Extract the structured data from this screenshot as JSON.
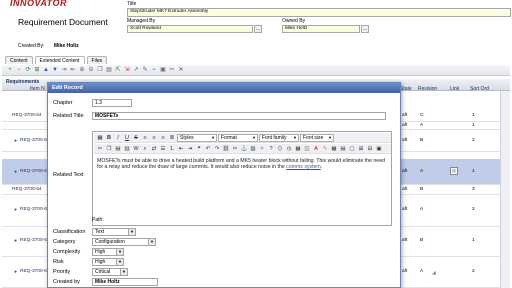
{
  "header": {
    "logo": "INNOVATOR",
    "doc_title": "Requirement Document",
    "created_by_label": "Created By:",
    "created_by_value": "Mike Holtz",
    "title_label": "Title",
    "title_value": "StepStruder MK7 Extruder Assembly",
    "managed_by_label": "Managed By",
    "managed_by_value": "Scott Rowland",
    "owned_by_label": "Owned By",
    "owned_by_value": "Mike Holtz"
  },
  "tabs": [
    {
      "label": "Content"
    },
    {
      "label": "Extended Content"
    },
    {
      "label": "Files"
    }
  ],
  "toolbar_icons": [
    "add-icon",
    "remove-icon",
    "refresh-icon",
    "add-child-icon",
    "move-up-icon",
    "move-down-icon",
    "indent-icon",
    "outdent-icon",
    "expand-icon",
    "collapse-icon",
    "copy-icon",
    "paste-icon",
    "export-icon",
    "import-icon",
    "link-icon",
    "edit-icon",
    "attach-icon",
    "delete-icon",
    "cut-icon",
    "close-icon"
  ],
  "grid": {
    "group_label": "Requirements",
    "item_col": "Item N",
    "columns": [
      "State",
      "Revision",
      "Link",
      "Sort Ord"
    ],
    "rows": [
      {
        "label": "REQ-3700-64",
        "state": "aft",
        "revision": "C",
        "link": "",
        "sort": "1"
      },
      {
        "label": "REQ-3700-64",
        "state": "aft",
        "revision": "A",
        "link": "",
        "sort": "1"
      },
      {
        "label": "REQ-3700-64",
        "state": "aft",
        "revision": "B",
        "link": "",
        "sort": "2"
      },
      {
        "label": "REQ-3700-64",
        "state": "aft",
        "revision": "A",
        "link": "",
        "sort": "1"
      },
      {
        "label": "REQ-3700-64",
        "state": "aft",
        "revision": "B",
        "link": "",
        "sort": "3"
      },
      {
        "label": "REQ-3700-64",
        "state": "aft",
        "revision": "A",
        "link": "",
        "sort": "2"
      },
      {
        "label": "REQ-3700-64",
        "state": "aft",
        "revision": "B",
        "link": "",
        "sort": "1"
      },
      {
        "label": "REQ-3700-64",
        "state": "aft",
        "revision": "A",
        "link": "",
        "sort": "2"
      }
    ]
  },
  "dialog": {
    "title": "Edit Record",
    "chapter_label": "Chapter",
    "chapter_value": "1.3",
    "related_title_label": "Related Title",
    "related_title_value": "MOSFETs",
    "related_text_label": "Related Text",
    "editor": {
      "styles": "Styles",
      "format": "Format",
      "font_family": "Font family",
      "font_size": "Font size",
      "text_before_link": "MOSFETs must be able to drive a heated build platform and a MK5 heater block without failing. This would eliminate the need for a relay and reduce the draw of large currents. It would also reduce noise in the ",
      "link_text": "comms system",
      "text_after_link": ".",
      "path_label": "Path:"
    },
    "fields": [
      {
        "label": "Classification",
        "value": "Text"
      },
      {
        "label": "Category",
        "value": "Configuration"
      },
      {
        "label": "Complexity",
        "value": "High"
      },
      {
        "label": "Risk",
        "value": "High"
      },
      {
        "label": "Priority",
        "value": "Critical"
      },
      {
        "label": "Created by",
        "value": "Mike Holtz"
      }
    ]
  },
  "colors": {
    "accent": "#3f63a8",
    "logo_red": "#b3181b",
    "selected_row": "#c0cde8",
    "header_field": "#fdfde0"
  }
}
